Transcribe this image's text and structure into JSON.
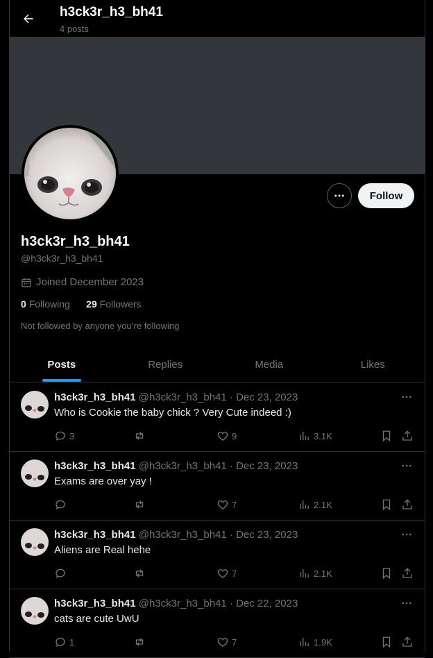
{
  "header": {
    "title": "h3ck3r_h3_bh41",
    "post_count": "4 posts"
  },
  "profile": {
    "name": "h3ck3r_h3_bh41",
    "handle": "@h3ck3r_h3_bh41",
    "joined": "Joined December 2023",
    "following_count": "0",
    "following_label": "Following",
    "followers_count": "29",
    "followers_label": "Followers",
    "not_followed": "Not followed by anyone you’re following",
    "follow_label": "Follow"
  },
  "tabs": [
    {
      "label": "Posts",
      "active": true
    },
    {
      "label": "Replies"
    },
    {
      "label": "Media"
    },
    {
      "label": "Likes"
    }
  ],
  "posts": [
    {
      "name": "h3ck3r_h3_bh41",
      "meta": "@h3ck3r_h3_bh41 · Dec 23, 2023",
      "text": "Who is Cookie the baby chick ? Very Cute indeed :)",
      "replies": "3",
      "reposts": "",
      "likes": "9",
      "views": "3.1K"
    },
    {
      "name": "h3ck3r_h3_bh41",
      "meta": "@h3ck3r_h3_bh41 · Dec 23, 2023",
      "text": "Exams are over yay !",
      "replies": "",
      "reposts": "",
      "likes": "7",
      "views": "2.1K"
    },
    {
      "name": "h3ck3r_h3_bh41",
      "meta": "@h3ck3r_h3_bh41 · Dec 23, 2023",
      "text": "Aliens are Real hehe",
      "replies": "",
      "reposts": "",
      "likes": "7",
      "views": "2.1K"
    },
    {
      "name": "h3ck3r_h3_bh41",
      "meta": "@h3ck3r_h3_bh41 · Dec 22, 2023",
      "text": "cats are cute UwU",
      "replies": "1",
      "reposts": "",
      "likes": "7",
      "views": "1.9K"
    }
  ],
  "colors": {
    "accent": "#1d9bf0",
    "banner": "#33363a",
    "muted": "#71767b"
  }
}
